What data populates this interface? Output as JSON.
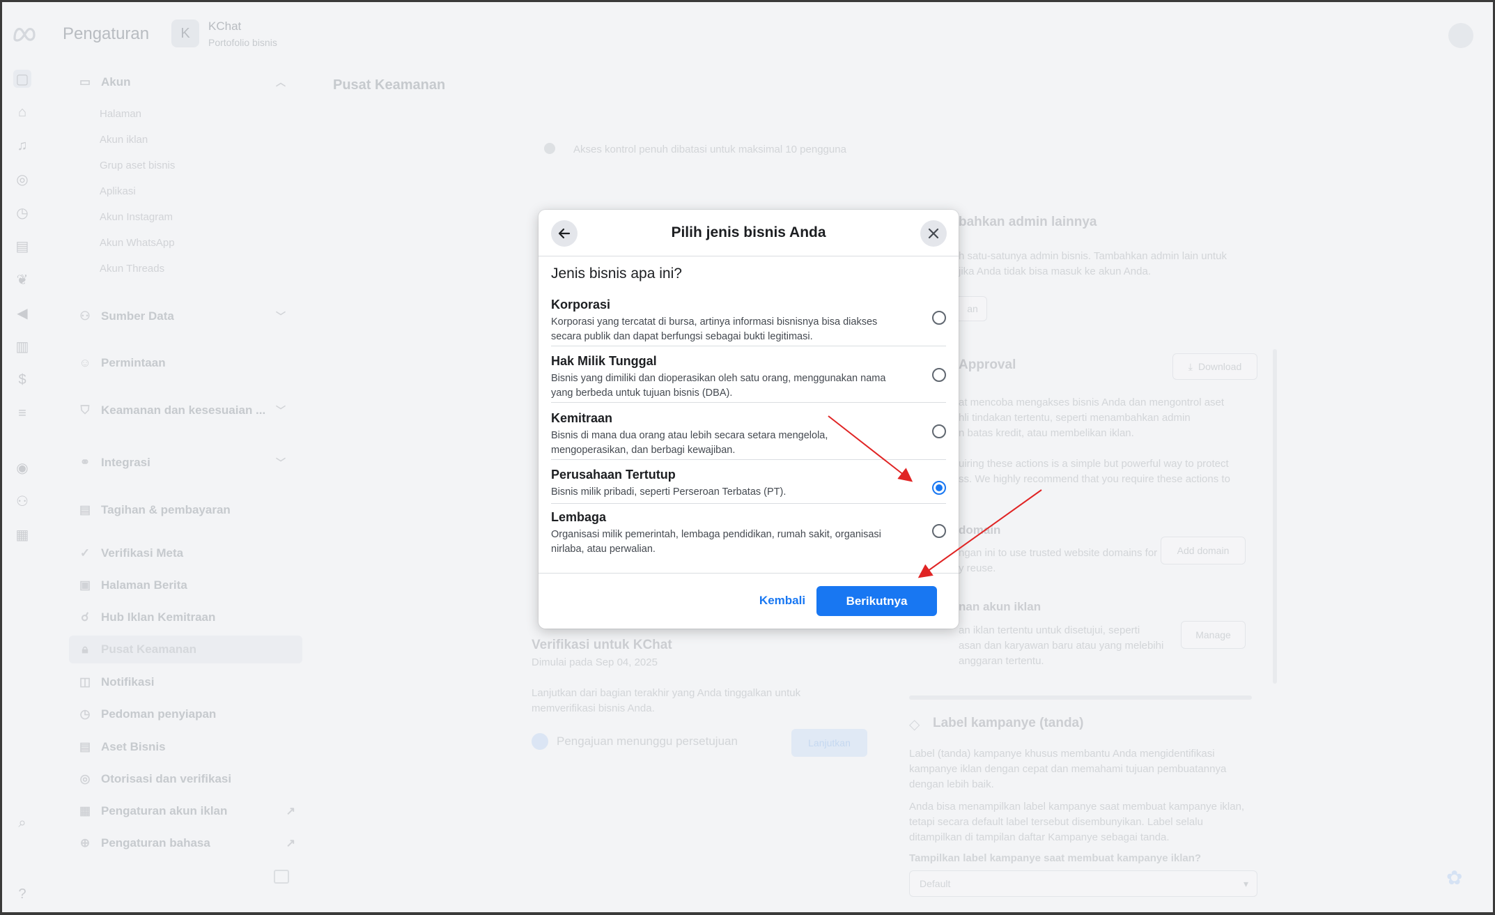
{
  "app": {
    "title": "Pengaturan",
    "business": {
      "initial": "K",
      "name": "KChat",
      "subtitle": "Portofolio bisnis"
    }
  },
  "sidebar": {
    "items": [
      {
        "label": "Akun",
        "icon": "folder-icon"
      },
      {
        "label": "Sumber Data",
        "icon": "people-icon"
      },
      {
        "label": "Permintaan",
        "icon": "person-icon"
      },
      {
        "label": "Keamanan dan kesesuaian ...",
        "icon": "shield-icon"
      },
      {
        "label": "Integrasi",
        "icon": "link-icon"
      },
      {
        "label": "Tagihan & pembayaran",
        "icon": "receipt-icon"
      },
      {
        "label": "Verifikasi Meta",
        "icon": "check-icon"
      },
      {
        "label": "Halaman Berita",
        "icon": "news-icon"
      },
      {
        "label": "Hub Iklan Kemitraan",
        "icon": "handshake-icon"
      },
      {
        "label": "Pusat Keamanan",
        "icon": "lock-icon"
      },
      {
        "label": "Notifikasi",
        "icon": "bell-icon"
      },
      {
        "label": "Pedoman penyiapan",
        "icon": "guide-icon"
      },
      {
        "label": "Aset Bisnis",
        "icon": "briefcase-icon"
      },
      {
        "label": "Otorisasi dan verifikasi",
        "icon": "verified-icon"
      },
      {
        "label": "Pengaturan akun iklan",
        "icon": "ads-icon"
      },
      {
        "label": "Pengaturan bahasa",
        "icon": "globe-icon"
      }
    ],
    "sub_items": [
      "Halaman",
      "Akun iklan",
      "Grup aset bisnis",
      "Aplikasi",
      "Akun Instagram",
      "Akun WhatsApp",
      "Akun Threads"
    ]
  },
  "background": {
    "page_title": "Pusat Keamanan",
    "access_note": "Akses kontrol penuh dibatasi untuk maksimal 10 pengguna",
    "add_admin_title": "bahkan admin lainnya",
    "add_admin_text": "h satu-satunya admin bisnis. Tambahkan admin lain untuk\njika Anda tidak bisa masuk ke akun Anda.",
    "add_admin_btn": "an",
    "approval_title": "Approval",
    "download_btn": "Download",
    "approval_text": "at mencoba mengakses bisnis Anda dan mengontrol aset\nhli tindakan tertentu, seperti menambahkan admin\nn batas kredit, atau membelikan iklan.",
    "approval_text2": "uiring these actions is a simple but powerful way to protect\nss. We highly recommend that you require these actions to",
    "domain_title": "domain",
    "domain_text": "ngan ini to use trusted website domains for\ny reuse.",
    "add_domain_btn": "Add domain",
    "ad_account_title": "nan akun iklan",
    "ad_account_text": "an iklan tertentu untuk disetujui, seperti\nasan dan karyawan baru atau yang melebihi\nanggaran tertentu.",
    "manage_btn": "Manage",
    "verification_title": "Verifikasi untuk KChat",
    "verification_date": "Dimulai pada Sep 04, 2025",
    "verification_text": "Lanjutkan dari bagian terakhir yang Anda tinggalkan untuk\nmemverifikasi bisnis Anda.",
    "verification_status": "Pengajuan menunggu persetujuan",
    "continue_btn": "Lanjutkan",
    "campaign_title": "Label kampanye (tanda)",
    "campaign_text": "Label (tanda) kampanye khusus membantu Anda mengidentifikasi\nkampanye iklan dengan cepat dan memahami tujuan pembuatannya\ndengan lebih baik.",
    "campaign_text2": "Anda bisa menampilkan label kampanye saat membuat kampanye iklan,\ntetapi secara default label tersebut disembunyikan. Label selalu\nditampilkan di tampilan daftar Kampanye sebagai tanda.",
    "campaign_question": "Tampilkan label kampanye saat membuat kampanye iklan?",
    "campaign_select": "Default"
  },
  "modal": {
    "title": "Pilih jenis bisnis Anda",
    "question": "Jenis bisnis apa ini?",
    "options": [
      {
        "title": "Korporasi",
        "description": "Korporasi yang tercatat di bursa, artinya informasi bisnisnya bisa diakses secara publik dan dapat berfungsi sebagai bukti legitimasi.",
        "selected": false
      },
      {
        "title": "Hak Milik Tunggal",
        "description": "Bisnis yang dimiliki dan dioperasikan oleh satu orang, menggunakan nama yang berbeda untuk tujuan bisnis (DBA).",
        "selected": false
      },
      {
        "title": "Kemitraan",
        "description": "Bisnis di mana dua orang atau lebih secara setara mengelola, mengoperasikan, dan berbagi kewajiban.",
        "selected": false
      },
      {
        "title": "Perusahaan Tertutup",
        "description": "Bisnis milik pribadi, seperti Perseroan Terbatas (PT).",
        "selected": true
      },
      {
        "title": "Lembaga",
        "description": "Organisasi milik pemerintah, lembaga pendidikan, rumah sakit, organisasi nirlaba, atau perwalian.",
        "selected": false
      }
    ],
    "back_label": "Kembali",
    "next_label": "Berikutnya"
  },
  "colors": {
    "accent": "#1877f2",
    "annotation_arrow": "#e02424"
  }
}
